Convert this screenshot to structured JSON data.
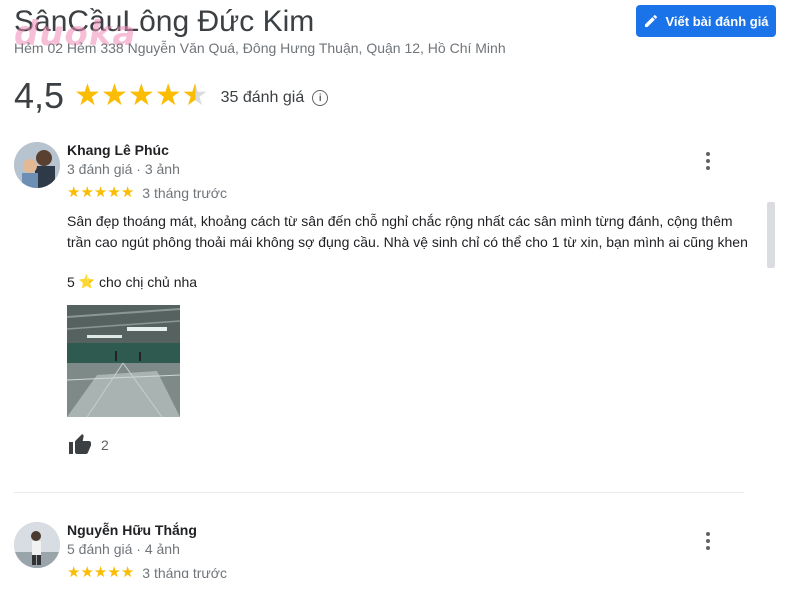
{
  "place": {
    "name": "SânCầuLông Đức Kim",
    "address": "Hẻm 02 Hẻm 338 Nguyễn Văn Quá, Đông Hưng Thuận, Quận 12, Hồ Chí Minh",
    "rating": "4,5",
    "rating_value": 4.5,
    "review_count": "35 đánh giá"
  },
  "watermark": "duoka",
  "write_review_button": {
    "label": "Viết bài đánh giá",
    "icon": "pencil-icon"
  },
  "colors": {
    "accent": "#1a73e8",
    "star": "#fbbc04",
    "muted": "#70757a"
  },
  "reviews": [
    {
      "name": "Khang Lê Phúc",
      "meta": "3 đánh giá · 3 ảnh",
      "stars": 5,
      "date": "3 tháng trước",
      "text": "Sân đẹp thoáng mát, khoảng cách từ sân đến chỗ nghỉ chắc rộng nhất các sân mình từng đánh, cộng thêm trần cao ngút phông thoải mái không sợ đụng cầu. Nhà vệ sinh chỉ có thể cho 1 từ xin, bạn mình ai cũng khen",
      "footer_number": "5",
      "footer_emoji": "⭐",
      "footer_text": "cho chị chủ nha",
      "likes": "2"
    },
    {
      "name": "Nguyễn Hữu Thắng",
      "meta": "5 đánh giá · 4 ảnh",
      "stars": 5,
      "date": "3 tháng trước"
    }
  ]
}
